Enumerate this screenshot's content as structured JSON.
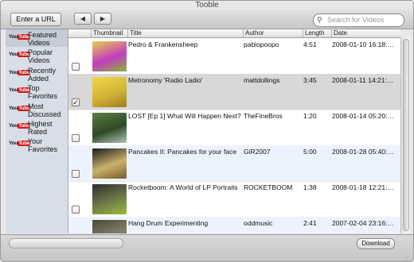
{
  "window": {
    "title": "Tooble"
  },
  "toolbar": {
    "enter_url_label": "Enter a URL",
    "back_icon": "◀",
    "forward_icon": "▶",
    "search_placeholder": "Search for Videos"
  },
  "sidebar": {
    "logo_you": "You",
    "logo_tube": "Tube",
    "items": [
      {
        "label": "Featured Videos",
        "selected": true
      },
      {
        "label": "Popular Videos",
        "selected": false
      },
      {
        "label": "Recently Added",
        "selected": false
      },
      {
        "label": "Top Favorites",
        "selected": false
      },
      {
        "label": "Most Discussed",
        "selected": false
      },
      {
        "label": "Highest Rated",
        "selected": false
      },
      {
        "label": "Your Favorites",
        "selected": false
      }
    ]
  },
  "table": {
    "columns": [
      "Thumbnail",
      "Title",
      "Author",
      "Length",
      "Date"
    ],
    "rows": [
      {
        "checked": false,
        "title": "Pedro & Frankensheep",
        "author": "pablopoopo",
        "length": "4:51",
        "date": "2008-01-10 16:18:…",
        "thumb_colors": [
          "#e7d04a",
          "#c23cc0",
          "#86b533"
        ]
      },
      {
        "checked": true,
        "title": "Metronomy 'Radio Ladio'",
        "author": "mattdollings",
        "length": "3:45",
        "date": "2008-01-11 14:21:…",
        "thumb_colors": [
          "#f0d64a",
          "#d4b534",
          "#9a7d22"
        ]
      },
      {
        "checked": false,
        "title": "LOST [Ep 1] What Will Happen Next?",
        "author": "TheFineBros",
        "length": "1:20",
        "date": "2008-01-14 05:20:…",
        "thumb_colors": [
          "#5f7e45",
          "#2d4a26",
          "#b0c4b8"
        ]
      },
      {
        "checked": false,
        "title": "Pancakes II: Pancakes for your face",
        "author": "GiR2007",
        "length": "5:00",
        "date": "2008-01-28 05:40:…",
        "thumb_colors": [
          "#1b1b1b",
          "#c9b26c",
          "#7a5a2b"
        ]
      },
      {
        "checked": false,
        "title": "Rocketboom: A World of LP Portraits",
        "author": "ROCKETBOOM",
        "length": "1:38",
        "date": "2008-01-18 12:21:…",
        "thumb_colors": [
          "#2e2e2e",
          "#6d7b4a",
          "#9cbc3a"
        ]
      },
      {
        "checked": false,
        "title": "Hang Drum Experimenting",
        "author": "oddmusic",
        "length": "2:41",
        "date": "2007-02-04 23:16:…",
        "thumb_colors": [
          "#4a4a38",
          "#84806a",
          "#2b2b22"
        ]
      }
    ]
  },
  "bottom": {
    "download_label": "Download",
    "resize_glyph": "⋰"
  }
}
